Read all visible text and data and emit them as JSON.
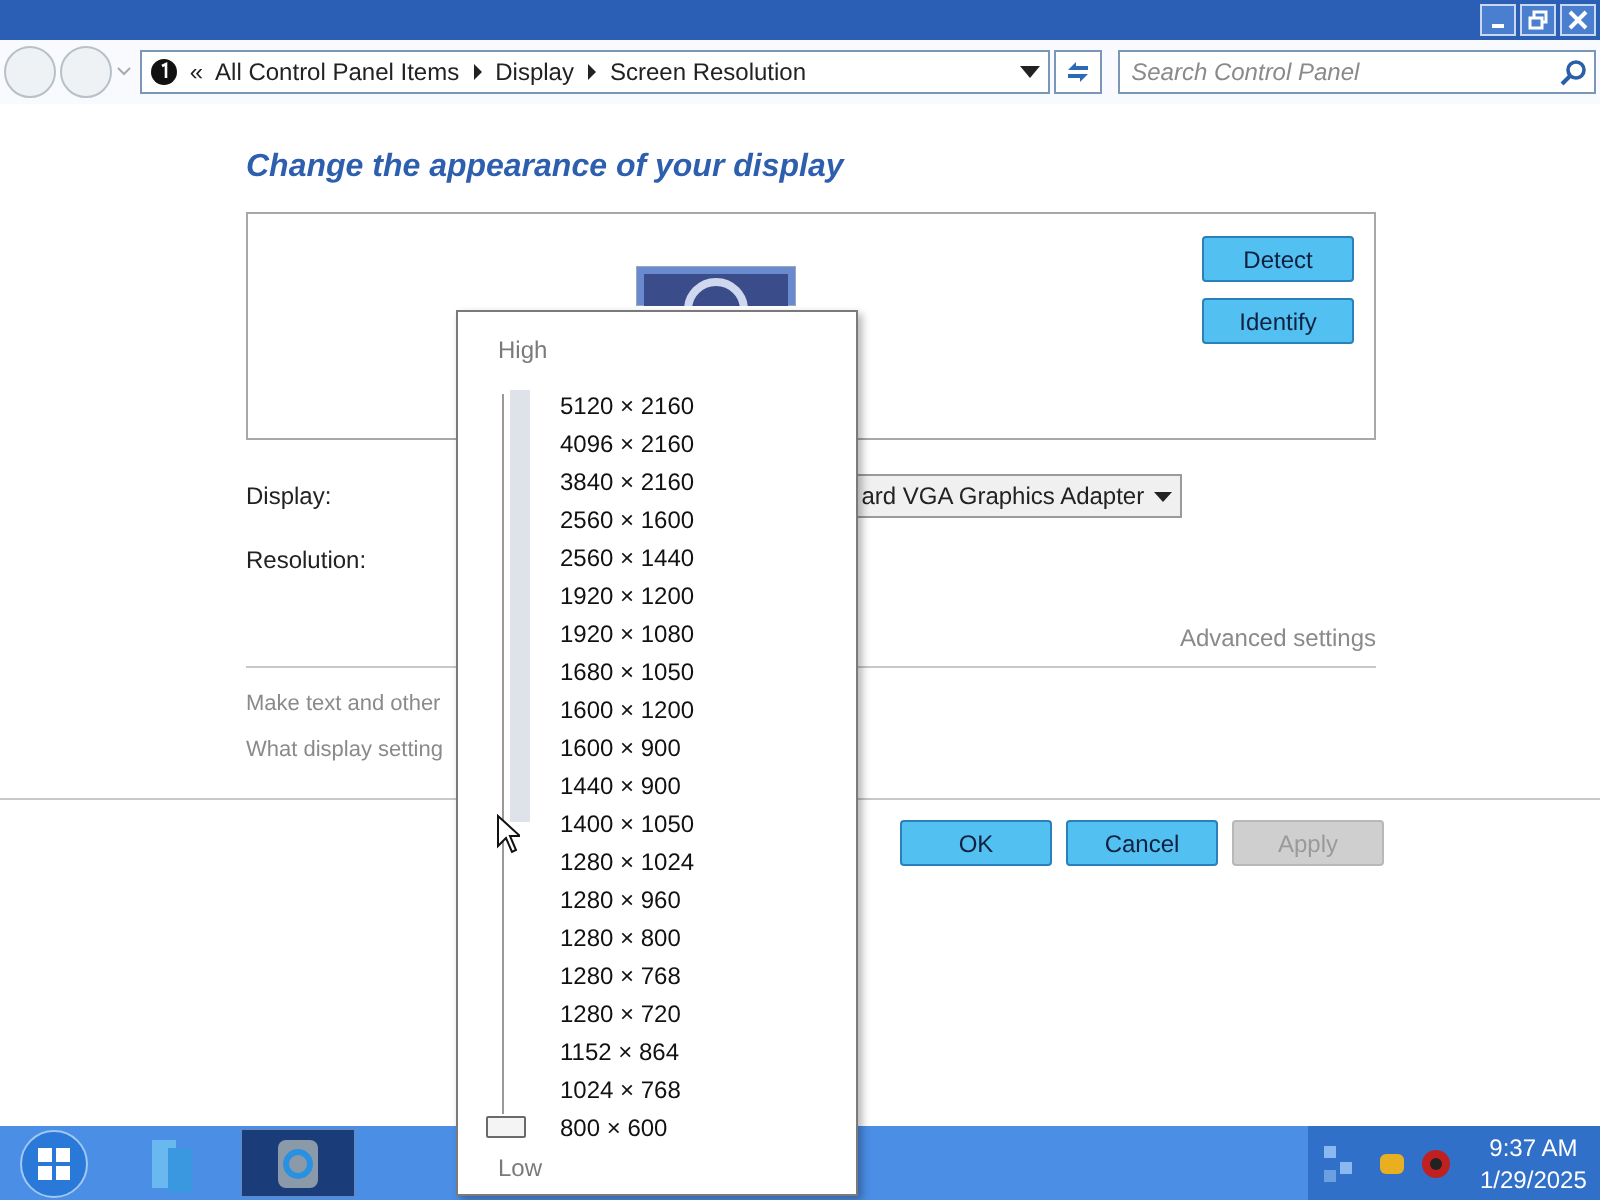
{
  "address_bar": {
    "overflow": "«",
    "crumbs": [
      "All Control Panel Items",
      "Display",
      "Screen Resolution"
    ]
  },
  "search": {
    "placeholder": "Search Control Panel"
  },
  "heading": "Change the appearance of your display",
  "display_buttons": [
    {
      "label": "Detect"
    },
    {
      "label": "Identify"
    }
  ],
  "fields": [
    {
      "label": "Display:",
      "value": "ard VGA Graphics Adapter"
    },
    {
      "label": "Resolution:"
    }
  ],
  "advanced_link": "Advanced settings",
  "help_links": [
    "Make text and other",
    "What display setting"
  ],
  "buttons": [
    {
      "label": "OK",
      "disabled": false
    },
    {
      "label": "Cancel",
      "disabled": false
    },
    {
      "label": "Apply",
      "disabled": true
    }
  ],
  "resolution_popup": {
    "high_label": "High",
    "low_label": "Low",
    "slider": {
      "level": 0
    },
    "options": [
      "5120 × 2160",
      "4096 × 2160",
      "3840 × 2160",
      "2560 × 1600",
      "2560 × 1440",
      "1920 × 1200",
      "1920 × 1080",
      "1680 × 1050",
      "1600 × 1200",
      "1600 × 900",
      "1440 × 900",
      "1400 × 1050",
      "1280 × 1024",
      "1280 × 960",
      "1280 × 800",
      "1280 × 768",
      "1280 × 720",
      "1152 × 864",
      "1024 × 768",
      "800 × 600"
    ]
  },
  "taskbar": {
    "time": "9:37 AM",
    "date": "1/29/2025"
  }
}
